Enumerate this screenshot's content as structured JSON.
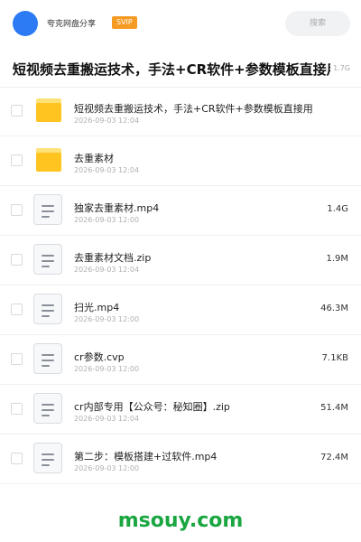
{
  "header": {
    "share_name": "夸克网盘分享",
    "badge": "SVIP",
    "search_placeholder": "搜索"
  },
  "folder": {
    "title": "短视频去重搬运技术，手法+CR软件+参数模板直接用",
    "size": "1.7G"
  },
  "files": [
    {
      "type": "folder",
      "name": "短视频去重搬运技术，手法+CR软件+参数模板直接用",
      "date": "2026-09-03 12:04",
      "size": ""
    },
    {
      "type": "folder",
      "name": "去重素材",
      "date": "2026-09-03 12:04",
      "size": ""
    },
    {
      "type": "file",
      "name": "独家去重素材.mp4",
      "date": "2026-09-03 12:00",
      "size": "1.4G"
    },
    {
      "type": "file",
      "name": "去重素材文档.zip",
      "date": "2026-09-03 12:04",
      "size": "1.9M"
    },
    {
      "type": "file",
      "name": "扫光.mp4",
      "date": "2026-09-03 12:00",
      "size": "46.3M"
    },
    {
      "type": "file",
      "name": "cr参数.cvp",
      "date": "2026-09-03 12:00",
      "size": "7.1KB"
    },
    {
      "type": "file",
      "name": "cr内部专用【公众号：秘知圈】.zip",
      "date": "2026-09-03 12:04",
      "size": "51.4M"
    },
    {
      "type": "file",
      "name": "第二步：模板搭建+过软件.mp4",
      "date": "2026-09-03 12:00",
      "size": "72.4M"
    }
  ],
  "watermark": "msouy.com",
  "colors": {
    "avatar": "#2d7bf4",
    "badge": "#f59a23",
    "folder": "#ffc41f",
    "watermark": "#1aa640"
  }
}
